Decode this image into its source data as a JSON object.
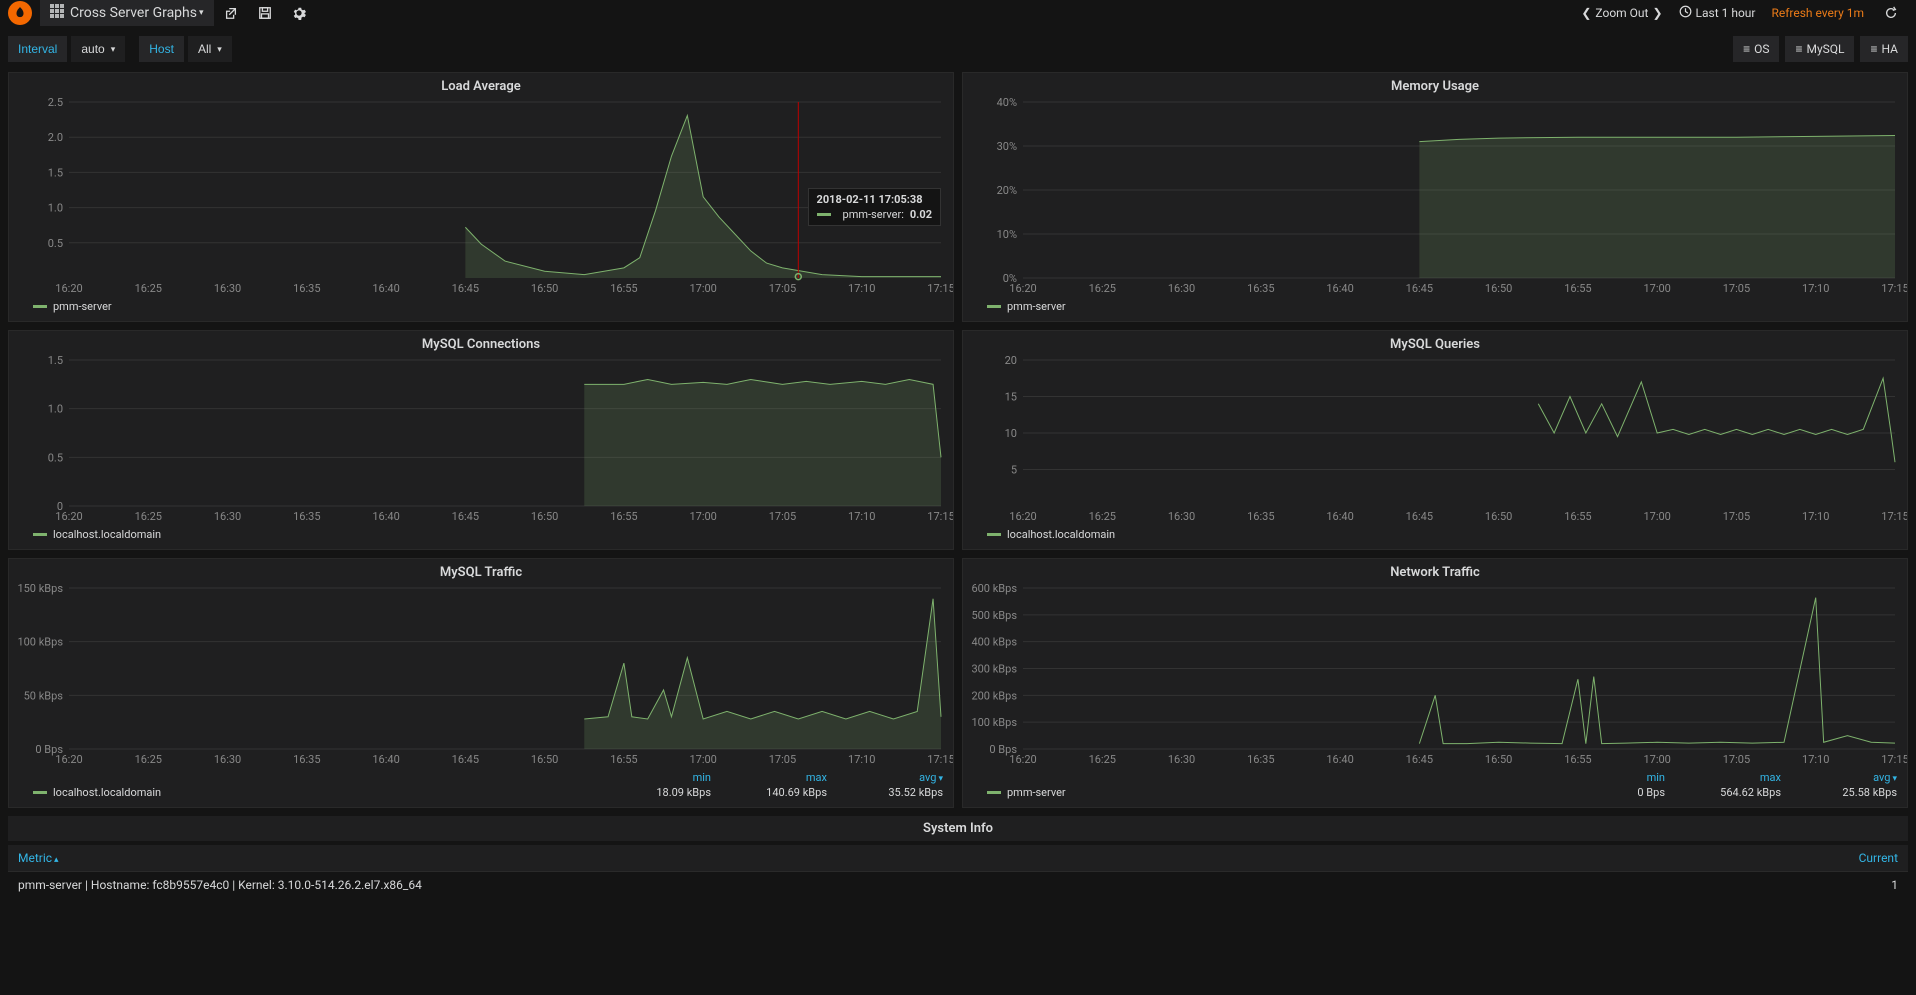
{
  "topbar": {
    "dashboard_title": "Cross Server Graphs",
    "zoom_out": "Zoom Out",
    "time_range": "Last 1 hour",
    "refresh": "Refresh every 1m"
  },
  "templates": {
    "interval_label": "Interval",
    "interval_value": "auto",
    "host_label": "Host",
    "host_value": "All"
  },
  "links": {
    "os": "OS",
    "mysql": "MySQL",
    "ha": "HA"
  },
  "tooltip": {
    "time": "2018-02-11 17:05:38",
    "series": "pmm-server:",
    "value": "0.02"
  },
  "row_title": "System Info",
  "sys_table": {
    "col_metric": "Metric",
    "col_current": "Current",
    "row1_metric": "pmm-server | Hostname: fc8b9557e4c0 | Kernel: 3.10.0-514.26.2.el7.x86_64",
    "row1_value": "1"
  },
  "legends": {
    "pmm": "pmm-server",
    "local": "localhost.localdomain"
  },
  "stats_header": {
    "min": "min",
    "max": "max",
    "avg": "avg"
  },
  "chart_data": [
    {
      "id": "load_average",
      "title": "Load Average",
      "type": "line",
      "legend": "pmm-server",
      "xlabels": [
        "16:20",
        "16:25",
        "16:30",
        "16:35",
        "16:40",
        "16:45",
        "16:50",
        "16:55",
        "17:00",
        "17:05",
        "17:10",
        "17:15"
      ],
      "ylabels": [
        "0.5",
        "1.0",
        "1.5",
        "2.0",
        "2.5"
      ],
      "ylim": [
        0,
        2.6
      ],
      "series": [
        {
          "name": "pmm-server",
          "points": [
            [
              0,
              null
            ],
            [
              1,
              null
            ],
            [
              2,
              null
            ],
            [
              3,
              null
            ],
            [
              4,
              null
            ],
            [
              5,
              0.75
            ],
            [
              5.2,
              0.5
            ],
            [
              5.5,
              0.25
            ],
            [
              6,
              0.1
            ],
            [
              6.5,
              0.05
            ],
            [
              7,
              0.15
            ],
            [
              7.2,
              0.3
            ],
            [
              7.4,
              1.0
            ],
            [
              7.6,
              1.8
            ],
            [
              7.8,
              2.4
            ],
            [
              8,
              1.2
            ],
            [
              8.2,
              0.9
            ],
            [
              8.4,
              0.65
            ],
            [
              8.6,
              0.4
            ],
            [
              8.8,
              0.22
            ],
            [
              9,
              0.15
            ],
            [
              9.5,
              0.05
            ],
            [
              10,
              0.02
            ],
            [
              10.5,
              0.02
            ],
            [
              11,
              0.02
            ]
          ]
        }
      ],
      "crosshair_x": 9.2,
      "fill": true
    },
    {
      "id": "memory_usage",
      "title": "Memory Usage",
      "type": "area",
      "legend": "pmm-server",
      "xlabels": [
        "16:20",
        "16:25",
        "16:30",
        "16:35",
        "16:40",
        "16:45",
        "16:50",
        "16:55",
        "17:00",
        "17:05",
        "17:10",
        "17:15"
      ],
      "ylabels": [
        "0%",
        "10%",
        "20%",
        "30%",
        "40%"
      ],
      "ylim": [
        0,
        40
      ],
      "series": [
        {
          "name": "pmm-server",
          "points": [
            [
              0,
              null
            ],
            [
              1,
              null
            ],
            [
              2,
              null
            ],
            [
              3,
              null
            ],
            [
              4,
              null
            ],
            [
              5,
              31
            ],
            [
              5.5,
              31.5
            ],
            [
              6,
              31.8
            ],
            [
              7,
              32
            ],
            [
              8,
              32
            ],
            [
              9,
              32
            ],
            [
              10,
              32.2
            ],
            [
              11,
              32.4
            ]
          ]
        }
      ],
      "fill": true
    },
    {
      "id": "mysql_conn",
      "title": "MySQL Connections",
      "type": "area",
      "legend": "localhost.localdomain",
      "xlabels": [
        "16:20",
        "16:25",
        "16:30",
        "16:35",
        "16:40",
        "16:45",
        "16:50",
        "16:55",
        "17:00",
        "17:05",
        "17:10",
        "17:15"
      ],
      "ylabels": [
        "0",
        "0.5",
        "1.0",
        "1.5"
      ],
      "ylim": [
        0,
        1.5
      ],
      "series": [
        {
          "name": "localhost.localdomain",
          "points": [
            [
              0,
              null
            ],
            [
              1,
              null
            ],
            [
              2,
              null
            ],
            [
              3,
              null
            ],
            [
              4,
              null
            ],
            [
              5,
              null
            ],
            [
              6,
              null
            ],
            [
              6.5,
              1.25
            ],
            [
              7,
              1.25
            ],
            [
              7.3,
              1.3
            ],
            [
              7.6,
              1.25
            ],
            [
              8,
              1.27
            ],
            [
              8.3,
              1.25
            ],
            [
              8.6,
              1.3
            ],
            [
              9,
              1.25
            ],
            [
              9.3,
              1.28
            ],
            [
              9.6,
              1.25
            ],
            [
              10,
              1.28
            ],
            [
              10.3,
              1.25
            ],
            [
              10.6,
              1.3
            ],
            [
              10.9,
              1.25
            ],
            [
              11,
              0.5
            ]
          ]
        }
      ],
      "fill": true
    },
    {
      "id": "mysql_queries",
      "title": "MySQL Queries",
      "type": "line",
      "legend": "localhost.localdomain",
      "xlabels": [
        "16:20",
        "16:25",
        "16:30",
        "16:35",
        "16:40",
        "16:45",
        "16:50",
        "16:55",
        "17:00",
        "17:05",
        "17:10",
        "17:15"
      ],
      "ylabels": [
        "5",
        "10",
        "15",
        "20"
      ],
      "ylim": [
        0,
        20
      ],
      "series": [
        {
          "name": "localhost.localdomain",
          "points": [
            [
              0,
              null
            ],
            [
              1,
              null
            ],
            [
              2,
              null
            ],
            [
              3,
              null
            ],
            [
              4,
              null
            ],
            [
              5,
              null
            ],
            [
              6,
              null
            ],
            [
              6.5,
              14
            ],
            [
              6.7,
              10
            ],
            [
              6.9,
              15
            ],
            [
              7.1,
              10
            ],
            [
              7.3,
              14
            ],
            [
              7.5,
              9.5
            ],
            [
              7.8,
              17
            ],
            [
              8,
              10
            ],
            [
              8.2,
              10.5
            ],
            [
              8.4,
              9.8
            ],
            [
              8.6,
              10.5
            ],
            [
              8.8,
              9.8
            ],
            [
              9,
              10.5
            ],
            [
              9.2,
              9.8
            ],
            [
              9.4,
              10.5
            ],
            [
              9.6,
              9.8
            ],
            [
              9.8,
              10.5
            ],
            [
              10,
              9.8
            ],
            [
              10.2,
              10.5
            ],
            [
              10.4,
              9.8
            ],
            [
              10.6,
              10.5
            ],
            [
              10.85,
              17.5
            ],
            [
              10.95,
              10
            ],
            [
              11,
              6
            ]
          ]
        }
      ],
      "fill": false
    },
    {
      "id": "mysql_traffic",
      "title": "MySQL Traffic",
      "type": "line",
      "legend": "localhost.localdomain",
      "xlabels": [
        "16:20",
        "16:25",
        "16:30",
        "16:35",
        "16:40",
        "16:45",
        "16:50",
        "16:55",
        "17:00",
        "17:05",
        "17:10",
        "17:15"
      ],
      "ylabels": [
        "0 Bps",
        "50 kBps",
        "100 kBps",
        "150 kBps"
      ],
      "ylim": [
        0,
        150
      ],
      "series": [
        {
          "name": "localhost.localdomain",
          "points": [
            [
              0,
              null
            ],
            [
              1,
              null
            ],
            [
              2,
              null
            ],
            [
              3,
              null
            ],
            [
              4,
              null
            ],
            [
              5,
              null
            ],
            [
              6,
              null
            ],
            [
              6.5,
              28
            ],
            [
              6.8,
              30
            ],
            [
              7,
              80
            ],
            [
              7.1,
              30
            ],
            [
              7.3,
              28
            ],
            [
              7.5,
              55
            ],
            [
              7.6,
              30
            ],
            [
              7.8,
              85
            ],
            [
              8,
              28
            ],
            [
              8.3,
              35
            ],
            [
              8.6,
              28
            ],
            [
              8.9,
              35
            ],
            [
              9.2,
              28
            ],
            [
              9.5,
              35
            ],
            [
              9.8,
              28
            ],
            [
              10.1,
              35
            ],
            [
              10.4,
              28
            ],
            [
              10.7,
              35
            ],
            [
              10.9,
              140
            ],
            [
              11,
              30
            ]
          ]
        }
      ],
      "fill": true,
      "stats": {
        "min": "18.09 kBps",
        "max": "140.69 kBps",
        "avg": "35.52 kBps"
      }
    },
    {
      "id": "network_traffic",
      "title": "Network Traffic",
      "type": "line",
      "legend": "pmm-server",
      "xlabels": [
        "16:20",
        "16:25",
        "16:30",
        "16:35",
        "16:40",
        "16:45",
        "16:50",
        "16:55",
        "17:00",
        "17:05",
        "17:10",
        "17:15"
      ],
      "ylabels": [
        "0 Bps",
        "100 kBps",
        "200 kBps",
        "300 kBps",
        "400 kBps",
        "500 kBps",
        "600 kBps"
      ],
      "ylim": [
        0,
        600
      ],
      "series": [
        {
          "name": "pmm-server",
          "points": [
            [
              0,
              null
            ],
            [
              1,
              null
            ],
            [
              2,
              null
            ],
            [
              3,
              null
            ],
            [
              4,
              null
            ],
            [
              5,
              20
            ],
            [
              5.2,
              200
            ],
            [
              5.3,
              20
            ],
            [
              5.6,
              20
            ],
            [
              6,
              25
            ],
            [
              6.4,
              22
            ],
            [
              6.8,
              20
            ],
            [
              7,
              260
            ],
            [
              7.1,
              20
            ],
            [
              7.2,
              270
            ],
            [
              7.3,
              20
            ],
            [
              7.6,
              22
            ],
            [
              8,
              25
            ],
            [
              8.4,
              22
            ],
            [
              8.8,
              25
            ],
            [
              9.2,
              22
            ],
            [
              9.6,
              25
            ],
            [
              10,
              564
            ],
            [
              10.1,
              25
            ],
            [
              10.4,
              50
            ],
            [
              10.7,
              25
            ],
            [
              11,
              22
            ]
          ]
        }
      ],
      "fill": false,
      "stats": {
        "min": "0 Bps",
        "max": "564.62 kBps",
        "avg": "25.58 kBps"
      }
    }
  ]
}
